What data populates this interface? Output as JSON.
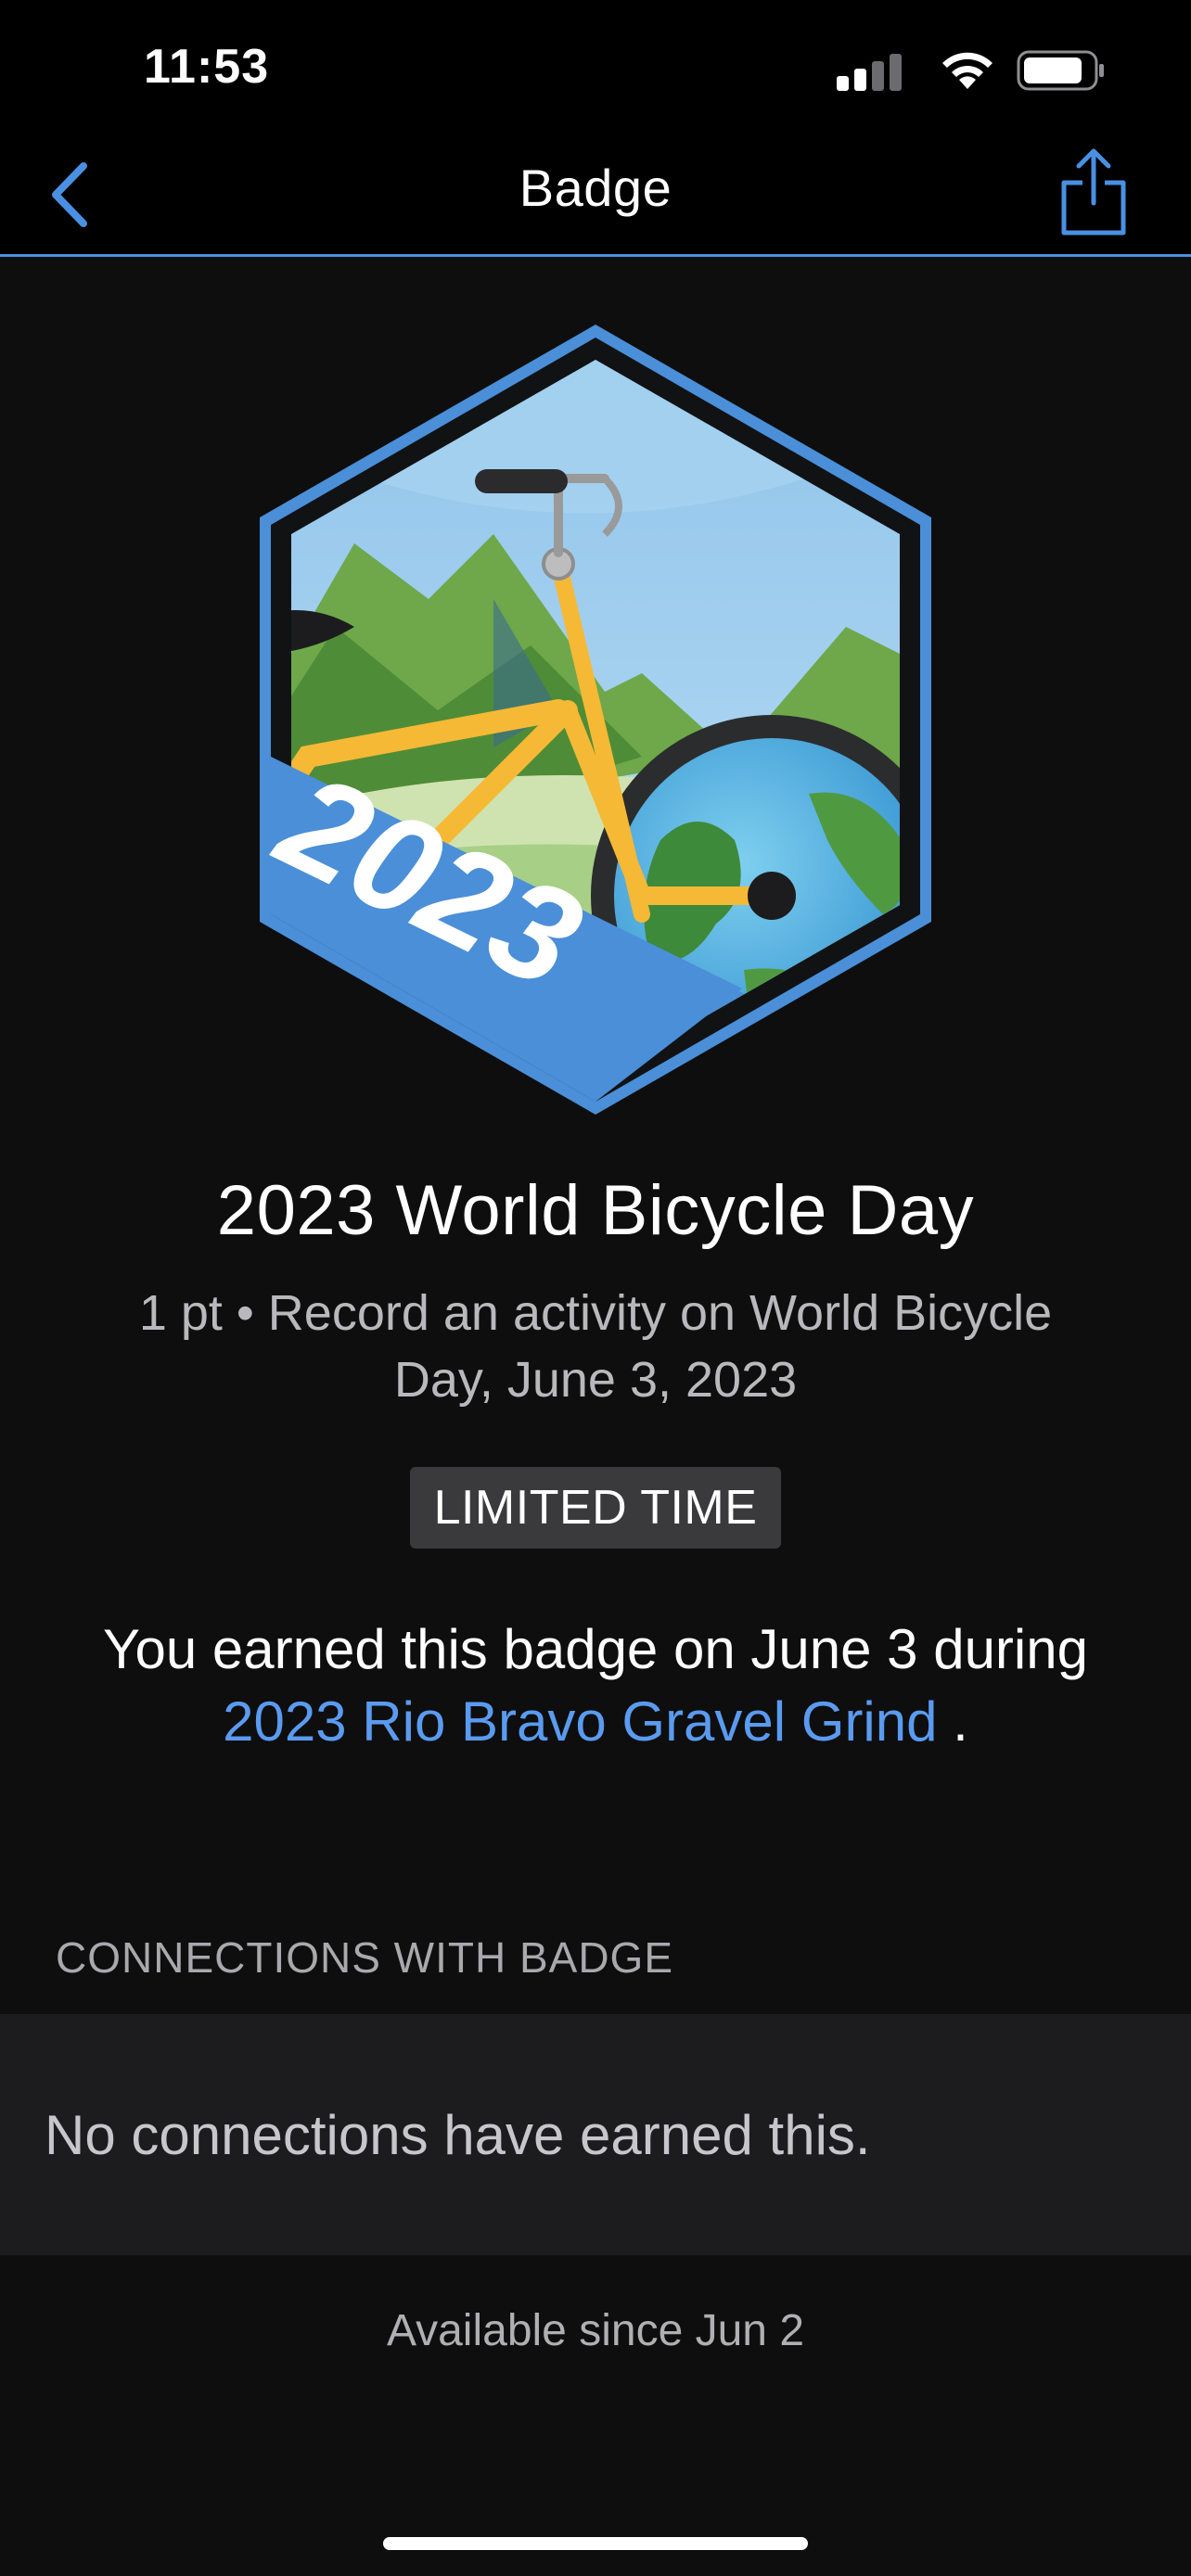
{
  "status_bar": {
    "time": "11:53",
    "icons": [
      "cellular-signal-icon",
      "wifi-icon",
      "battery-icon"
    ]
  },
  "nav": {
    "title": "Badge",
    "back_icon": "chevron-left-icon",
    "share_icon": "share-icon"
  },
  "badge": {
    "image_year": "2023",
    "title": "2023 World Bicycle Day",
    "description": "1 pt • Record an activity on World Bicycle Day, June 3, 2023",
    "tag": "LIMITED TIME",
    "earned_prefix": "You earned this badge on June 3 during",
    "earned_event": "2023 Rio Bravo Gravel Grind",
    "earned_suffix": " ."
  },
  "connections": {
    "header": "CONNECTIONS WITH BADGE",
    "empty_text": "No connections have earned this."
  },
  "footer": {
    "available": "Available since Jun 2"
  },
  "colors": {
    "accent": "#4a90e2",
    "link": "#5a9bf0",
    "background": "#0e0e0f",
    "panel": "#1c1c1e",
    "tag_bg": "#3a3a3c",
    "bike_yellow": "#f5b935"
  }
}
